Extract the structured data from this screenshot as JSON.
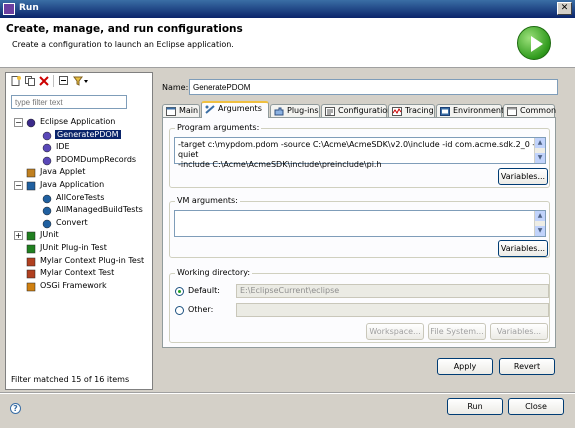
{
  "window": {
    "title": "Run"
  },
  "banner": {
    "heading": "Create, manage, and run configurations",
    "subheading": "Create a configuration to launch an Eclipse application."
  },
  "left": {
    "filter_placeholder": "type filter text",
    "tree": [
      {
        "label": "Eclipse Application",
        "depth": 0,
        "expander": "-",
        "icon": "eclipse-app-icon"
      },
      {
        "label": "GeneratePDOM",
        "depth": 1,
        "selected": true,
        "icon": "eclipse-config-icon"
      },
      {
        "label": "IDE",
        "depth": 1,
        "icon": "eclipse-config-icon"
      },
      {
        "label": "PDOMDumpRecords",
        "depth": 1,
        "icon": "eclipse-config-icon"
      },
      {
        "label": "Java Applet",
        "depth": 0,
        "icon": "java-applet-icon"
      },
      {
        "label": "Java Application",
        "depth": 0,
        "expander": "-",
        "icon": "java-app-icon"
      },
      {
        "label": "AllCoreTests",
        "depth": 1,
        "icon": "java-config-icon"
      },
      {
        "label": "AllManagedBuildTests",
        "depth": 1,
        "icon": "java-config-icon"
      },
      {
        "label": "Convert",
        "depth": 1,
        "icon": "java-config-icon"
      },
      {
        "label": "JUnit",
        "depth": 0,
        "expander": "+",
        "icon": "junit-icon"
      },
      {
        "label": "JUnit Plug-in Test",
        "depth": 0,
        "icon": "junit-plugin-icon"
      },
      {
        "label": "Mylar Context Plug-in Test",
        "depth": 0,
        "icon": "mylar-icon"
      },
      {
        "label": "Mylar Context Test",
        "depth": 0,
        "icon": "mylar-icon"
      },
      {
        "label": "OSGi Framework",
        "depth": 0,
        "icon": "osgi-icon"
      }
    ],
    "status": "Filter matched 15 of 16 items"
  },
  "name": {
    "label": "Name:",
    "value": "GeneratePDOM"
  },
  "tabs": [
    {
      "label": "Main"
    },
    {
      "label": "Arguments",
      "active": true
    },
    {
      "label": "Plug-ins"
    },
    {
      "label": "Configuration"
    },
    {
      "label": "Tracing"
    },
    {
      "label": "Environment"
    },
    {
      "label": "Common"
    }
  ],
  "program_args": {
    "title": "Program arguments:",
    "line1": "-target c:\\mypdom.pdom -source C:\\Acme\\AcmeSDK\\v2.0\\include -id com.acme.sdk.2_0 -quiet",
    "line2": "-include C:\\Acme\\AcmeSDK\\include\\preinclude\\pi.h",
    "variables_label": "Variables..."
  },
  "vm_args": {
    "title": "VM arguments:",
    "value": "",
    "variables_label": "Variables..."
  },
  "working_dir": {
    "title": "Working directory:",
    "default_label": "Default:",
    "default_value": "E:\\EclipseCurrent\\eclipse",
    "other_label": "Other:",
    "other_value": "",
    "workspace_label": "Workspace...",
    "filesystem_label": "File System...",
    "variables_label": "Variables..."
  },
  "actions": {
    "apply": "Apply",
    "revert": "Revert",
    "run": "Run",
    "close": "Close"
  },
  "colors": {
    "accent": "#0a246a",
    "run_green": "#2f9a1c"
  }
}
